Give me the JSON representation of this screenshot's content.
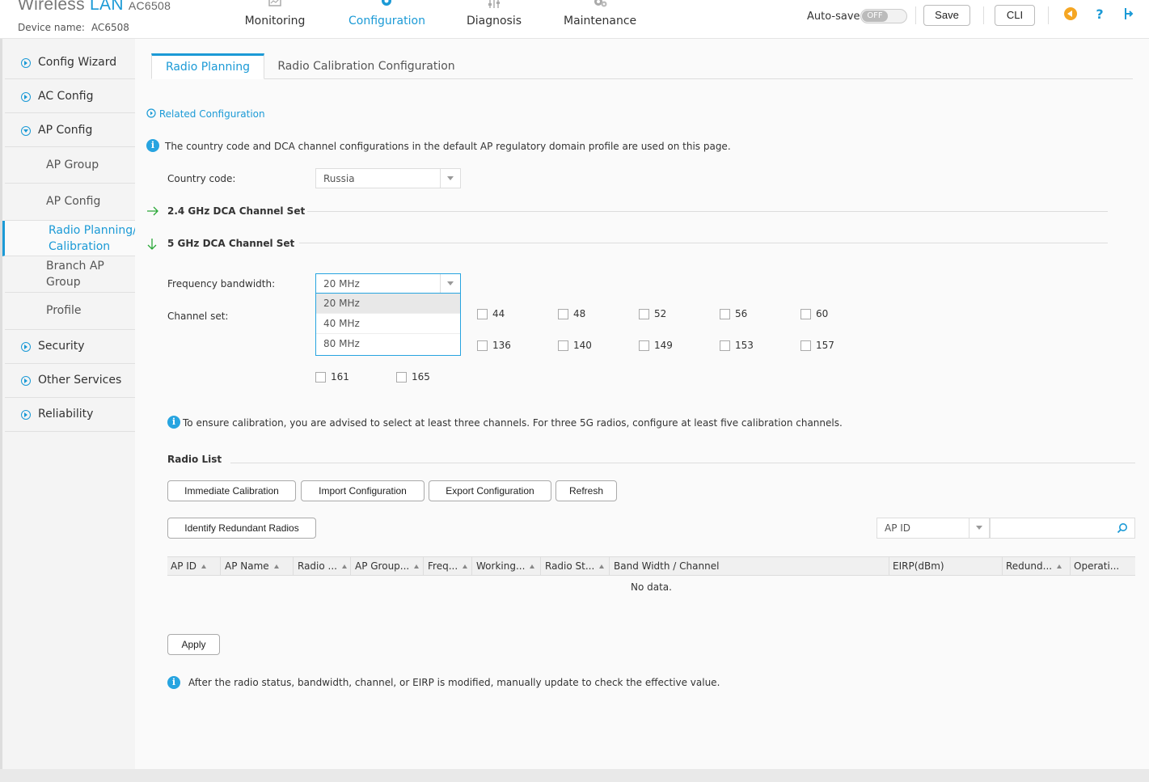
{
  "header": {
    "brand_word": "Wireless",
    "brand_lan": "LAN",
    "model": "AC6508",
    "device_label": "Device name:",
    "device_name": "AC6508",
    "nav": [
      {
        "label": "Monitoring",
        "icon": "monitor-icon"
      },
      {
        "label": "Configuration",
        "icon": "gear-icon",
        "active": true
      },
      {
        "label": "Diagnosis",
        "icon": "sliders-icon"
      },
      {
        "label": "Maintenance",
        "icon": "gears-icon"
      }
    ],
    "autosave_label": "Auto-save:",
    "autosave_state": "OFF",
    "save_label": "Save",
    "cli_label": "CLI",
    "colors": {
      "accent": "#1b9ad6",
      "orange": "#f5a623"
    }
  },
  "sidebar": {
    "items": [
      {
        "label": "Config Wizard"
      },
      {
        "label": "AC Config"
      },
      {
        "label": "AP Config",
        "expanded": true
      },
      {
        "label": "Security"
      },
      {
        "label": "Other Services"
      },
      {
        "label": "Reliability"
      }
    ],
    "subitems": [
      {
        "label": "AP Group"
      },
      {
        "label": "AP Config"
      },
      {
        "label_line1": "Radio Planning/",
        "label_line2": "Calibration",
        "active": true
      },
      {
        "label_line1": "Branch AP",
        "label_line2": "Group"
      },
      {
        "label": "Profile"
      }
    ]
  },
  "tabs": [
    {
      "label": "Radio Planning",
      "active": true
    },
    {
      "label": "Radio Calibration Configuration"
    }
  ],
  "content": {
    "related_link": "Related Configuration",
    "info_note": "The country code and DCA channel configurations in the default AP regulatory domain profile are used on this page.",
    "country_label": "Country code:",
    "country_value": "Russia",
    "section_24": "2.4 GHz DCA Channel Set",
    "section_5": "5 GHz DCA Channel Set",
    "bandwidth_label": "Frequency bandwidth:",
    "bandwidth_value": "20 MHz",
    "bandwidth_options": [
      "20 MHz",
      "40 MHz",
      "80 MHz"
    ],
    "channel_label": "Channel set:",
    "channels_row1": [
      "44",
      "48",
      "52",
      "56",
      "60"
    ],
    "channels_row2": [
      "136",
      "140",
      "149",
      "153",
      "157"
    ],
    "channels_row3": [
      "161",
      "165"
    ],
    "calib_note": "To ensure calibration, you are advised to select at least three channels. For three 5G radios, configure at least five calibration channels.",
    "radio_list_title": "Radio List",
    "buttons": {
      "immediate": "Immediate Calibration",
      "import": "Import Configuration",
      "export": "Export Configuration",
      "refresh": "Refresh",
      "identify": "Identify Redundant Radios",
      "apply": "Apply"
    },
    "filter_field": "AP ID",
    "columns": [
      "AP ID",
      "AP Name",
      "Radio ...",
      "AP Group...",
      "Freq...",
      "Working...",
      "Radio St...",
      "Band Width / Channel",
      "EIRP(dBm)",
      "Redund...",
      "Operati..."
    ],
    "no_data": "No data.",
    "bottom_note": "After the radio status, bandwidth, channel, or EIRP is modified, manually update to check the effective value."
  }
}
